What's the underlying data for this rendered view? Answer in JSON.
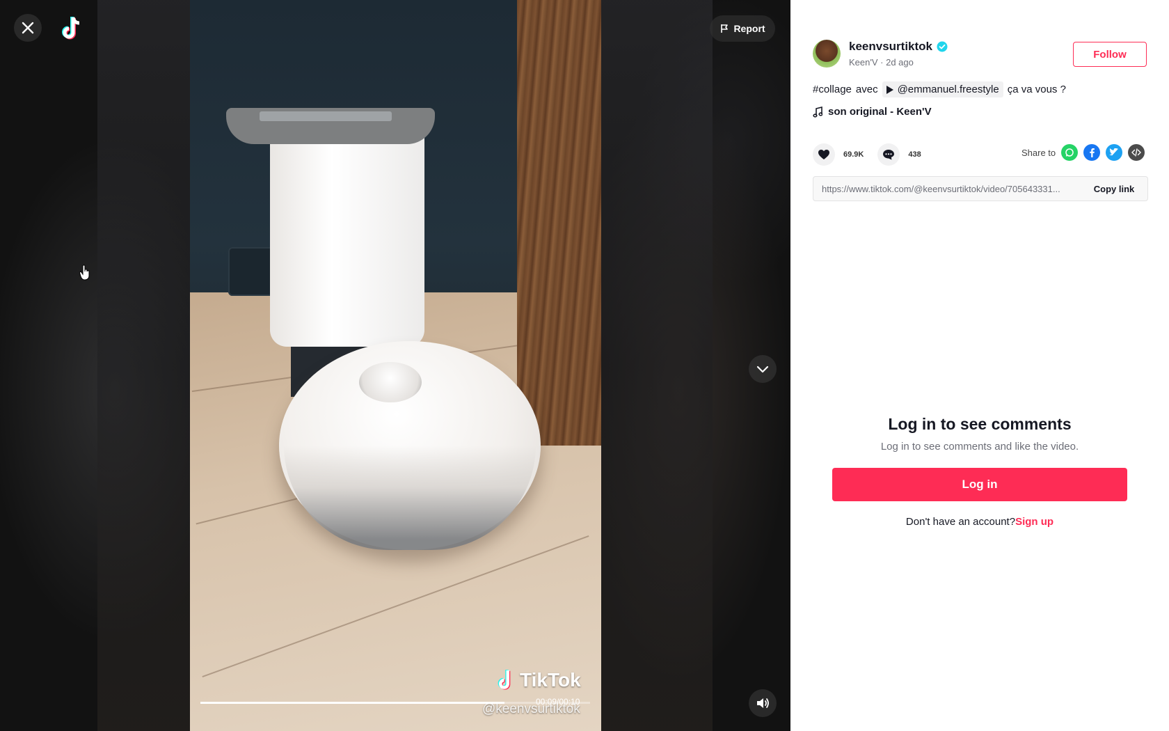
{
  "viewer": {
    "report_label": "Report",
    "watermark_brand": "TikTok",
    "watermark_handle": "@keenvsurtiktok",
    "time_display": "00:09/00:10",
    "progress": 0.78
  },
  "author": {
    "username": "keenvsurtiktok",
    "display_name": "Keen'V",
    "separator": "·",
    "posted": "2d ago",
    "verified": true,
    "follow_label": "Follow"
  },
  "caption": {
    "hashtag": "#collage",
    "connector": "avec",
    "mention": "@emmanuel.freestyle",
    "trailing": "ça va vous ?"
  },
  "music": {
    "label": "son original - Keen'V"
  },
  "stats": {
    "likes": "69.9K",
    "comments": "438"
  },
  "share": {
    "label": "Share to",
    "targets": [
      "whatsapp-icon",
      "facebook-icon",
      "twitter-icon",
      "embed-icon"
    ]
  },
  "link": {
    "url": "https://www.tiktok.com/@keenvsurtiktok/video/705643331...",
    "copy_label": "Copy link"
  },
  "comments_gate": {
    "title": "Log in to see comments",
    "subtitle": "Log in to see comments and like the video.",
    "login_label": "Log in",
    "no_account_text": "Don't have an account?",
    "signup_label": "Sign up"
  },
  "colors": {
    "accent": "#fe2c55",
    "verified": "#20d5ec",
    "whatsapp": "#25d366",
    "facebook": "#1877f2",
    "twitter": "#1da1f2",
    "embed": "#4b4b4b"
  }
}
